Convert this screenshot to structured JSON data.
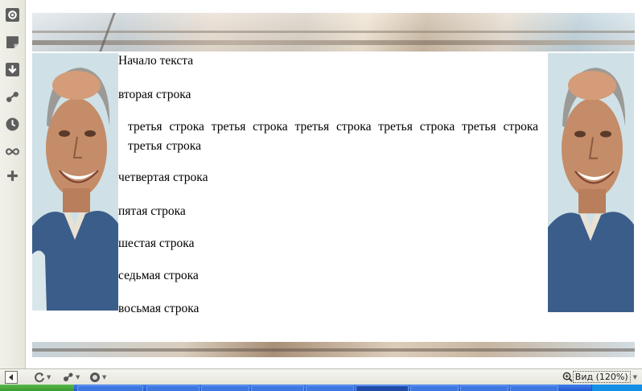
{
  "sidebar": {
    "buttons": [
      {
        "name": "panels-settings-icon",
        "glyph": "gear"
      },
      {
        "name": "notes-icon",
        "glyph": "note"
      },
      {
        "name": "downloads-icon",
        "glyph": "download"
      },
      {
        "name": "links-icon",
        "glyph": "link"
      },
      {
        "name": "history-icon",
        "glyph": "clock"
      },
      {
        "name": "unite-icon",
        "glyph": "loop"
      },
      {
        "name": "add-panel-icon",
        "glyph": "+"
      }
    ]
  },
  "page": {
    "lines": {
      "l1": "Начало текста",
      "l2": "вторая строка",
      "l3": "третья строка третья строка третья строка третья строка третья строка третья строка",
      "l4": "четвертая строка",
      "l5": "пятая строка",
      "l6": "шестая строка",
      "l7": "седьмая строка",
      "l8": "восьмая строка"
    }
  },
  "statusbar": {
    "zoom_label": "Вид (120%)"
  },
  "colors": {
    "taskbar": "#2459d3",
    "start": "#3a9a2e",
    "sidebar": "#e6e6dc"
  }
}
